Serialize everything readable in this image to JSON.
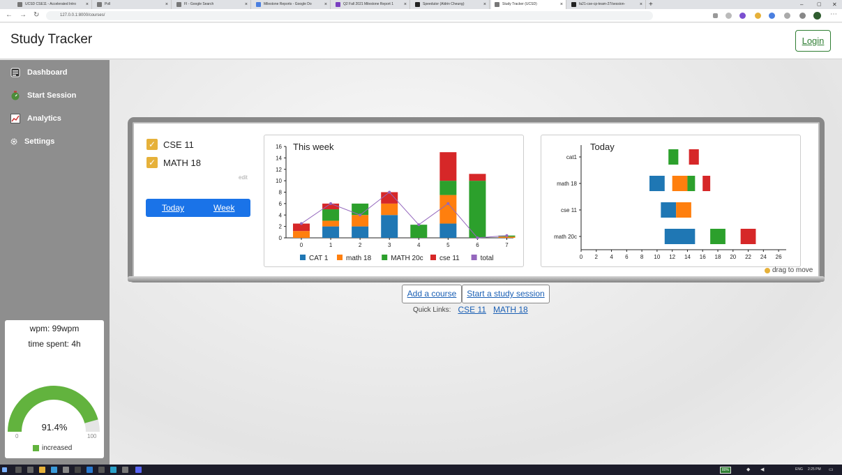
{
  "browser": {
    "tabs": [
      {
        "label": "UCSD CSE11 - Accelerated Intro"
      },
      {
        "label": "Poll"
      },
      {
        "label": "FI - Google Search"
      },
      {
        "label": "Milestone Reports - Google Do"
      },
      {
        "label": "Q2 Fall 2021 Milestone Report 1"
      },
      {
        "label": "Speedutor (Aldrin Cheung)"
      },
      {
        "label": "Study Tracker (UCSD)"
      },
      {
        "label": "fa21-cse-cp-team-27/session-"
      }
    ],
    "url": "127.0.0.1:8000/courses/"
  },
  "header": {
    "title": "Study Tracker",
    "login_label": "Login"
  },
  "sidebar": {
    "items": [
      {
        "label": "Dashboard",
        "icon": "dashboard-icon"
      },
      {
        "label": "Start Session",
        "icon": "timer-icon"
      },
      {
        "label": "Analytics",
        "icon": "chart-line-icon"
      },
      {
        "label": "Settings",
        "icon": "gear-icon"
      }
    ]
  },
  "stats": {
    "wpm": "wpm: 99wpm",
    "time_spent": "time spent: 4h",
    "gauge": {
      "value": 91.4,
      "label": "91.4%",
      "min_label": "0",
      "max_label": "100",
      "legend": "increased",
      "fill_color": "#62b33e",
      "track_color": "#e5e5e5"
    }
  },
  "courses": {
    "items": [
      {
        "label": "CSE 11"
      },
      {
        "label": "MATH 18"
      }
    ],
    "edit_label": "edit"
  },
  "range_toggle": {
    "today": "Today",
    "week": "Week"
  },
  "colors": {
    "cat1": "#1f77b4",
    "math18": "#ff7f0e",
    "math20c": "#2ca02c",
    "cse11": "#d62728",
    "total": "#9467bd"
  },
  "chart_data": [
    {
      "type": "bar",
      "title": "This week",
      "categories": [
        "0",
        "1",
        "2",
        "3",
        "4",
        "5",
        "6",
        "7"
      ],
      "ylim": [
        0,
        16
      ],
      "yticks": [
        "0",
        "2",
        "4",
        "6",
        "8",
        "10",
        "12",
        "14",
        "16"
      ],
      "stacked": true,
      "series": [
        {
          "name": "CAT 1",
          "values": [
            0,
            2,
            2,
            4,
            0,
            2.5,
            0,
            0
          ],
          "color": "#1f77b4"
        },
        {
          "name": "math 18",
          "values": [
            1.2,
            1,
            2,
            2,
            0,
            5,
            0,
            0.2
          ],
          "color": "#ff7f0e"
        },
        {
          "name": "MATH 20c",
          "values": [
            0,
            2,
            2,
            0,
            2.3,
            2.5,
            10,
            0.2
          ],
          "color": "#2ca02c"
        },
        {
          "name": "cse 11",
          "values": [
            1.3,
            1,
            0,
            2,
            0,
            5,
            1.2,
            0
          ],
          "color": "#d62728"
        },
        {
          "name": "total",
          "type": "line",
          "values": [
            2.5,
            6,
            4,
            8,
            2.3,
            6,
            0,
            0.4
          ],
          "color": "#9467bd"
        }
      ],
      "legend": [
        "CAT 1",
        "math 18",
        "MATH 20c",
        "cse 11",
        "total"
      ],
      "legend_placement": "bottom"
    },
    {
      "type": "bar",
      "orientation": "horizontal-ranges",
      "title": "Today",
      "categories": [
        "cat1",
        "math 18",
        "cse 11",
        "math 20c"
      ],
      "xlim": [
        0,
        27
      ],
      "xticks": [
        "0",
        "2",
        "4",
        "6",
        "8",
        "10",
        "12",
        "14",
        "16",
        "18",
        "20",
        "22",
        "24",
        "26"
      ],
      "ranges": [
        {
          "category": "cat1",
          "start": 11.5,
          "end": 12.8,
          "color": "#2ca02c"
        },
        {
          "category": "cat1",
          "start": 14.2,
          "end": 15.5,
          "color": "#d62728"
        },
        {
          "category": "math 18",
          "start": 9,
          "end": 11,
          "color": "#1f77b4"
        },
        {
          "category": "math 18",
          "start": 12,
          "end": 14,
          "color": "#ff7f0e"
        },
        {
          "category": "math 18",
          "start": 14,
          "end": 15,
          "color": "#2ca02c"
        },
        {
          "category": "math 18",
          "start": 16,
          "end": 17,
          "color": "#d62728"
        },
        {
          "category": "cse 11",
          "start": 10.5,
          "end": 12.5,
          "color": "#1f77b4"
        },
        {
          "category": "cse 11",
          "start": 12.5,
          "end": 14.5,
          "color": "#ff7f0e"
        },
        {
          "category": "math 20c",
          "start": 11,
          "end": 15,
          "color": "#1f77b4"
        },
        {
          "category": "math 20c",
          "start": 17,
          "end": 19,
          "color": "#2ca02c"
        },
        {
          "category": "math 20c",
          "start": 21,
          "end": 23,
          "color": "#d62728"
        }
      ]
    }
  ],
  "drag_hint": "drag to move",
  "actions": {
    "add_course": "Add a course",
    "start_session": "Start a study session"
  },
  "quick_links": {
    "label": "Quick Links:",
    "items": [
      "CSE 11",
      "MATH 18"
    ]
  },
  "taskbar": {
    "battery": "80%",
    "lang": "ENG",
    "time": "2:25 PM"
  }
}
